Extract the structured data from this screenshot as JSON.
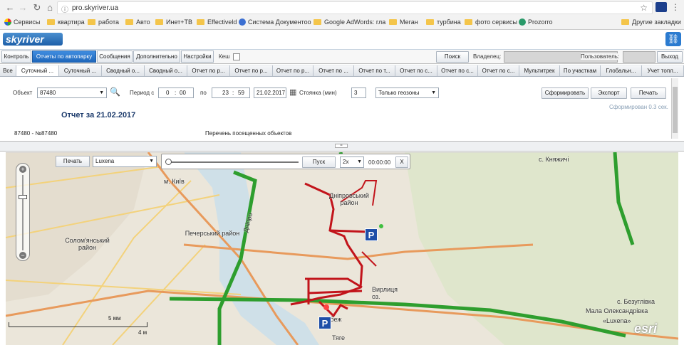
{
  "browser": {
    "url": "pro.skyriver.ua",
    "bookmarks": [
      "Сервисы",
      "квартира",
      "работа",
      "Авто",
      "Инет+ТВ",
      "Effectiveld",
      "Система Документоо",
      "Google AdWords: гла",
      "Меган",
      "турбина",
      "фото сервисы",
      "Prozorro"
    ],
    "other_bookmarks": "Другие закладки"
  },
  "app": {
    "logo": "skyriver"
  },
  "top_nav": {
    "tabs": [
      "Контроль",
      "Отчеты по автопарку",
      "Сообщения",
      "Дополнительно",
      "Настройки"
    ],
    "active_index": 1,
    "cache_label": "Кеш",
    "search_button": "Поиск",
    "owner_label": "Владелец:",
    "user_label": "Пользователь:",
    "exit_button": "Выход"
  },
  "report_tabs": [
    "Все",
    "Суточный ...",
    "Суточный ...",
    "Сводный о...",
    "Сводный о...",
    "Отчет по р...",
    "Отчет по р...",
    "Отчет по р...",
    "Отчет по ...",
    "Отчет по т...",
    "Отчет по с...",
    "Отчет по с...",
    "Отчет по с...",
    "Мультитрек",
    "По участкам",
    "Глобальн...",
    "Учет топл..."
  ],
  "form": {
    "object_label": "Объект",
    "object_value": "87480",
    "period_from_label": "Период с",
    "from_h": "0",
    "from_m": "00",
    "to_label": "по",
    "to_h": "23",
    "to_m": "59",
    "date": "21.02.2017",
    "stop_label": "Стоянка (мин)",
    "stop_value": "3",
    "geozone_value": "Только геозоны",
    "generate_button": "Сформировать",
    "export_button": "Экспорт",
    "print_button": "Печать",
    "generated_note": "Сформирован 0.3 сек."
  },
  "report": {
    "title": "Отчет за 21.02.2017",
    "row_left": "87480 - №87480",
    "row_right": "Перечень посещенных объектов"
  },
  "map": {
    "print_button": "Печать",
    "object_value": "Luxena",
    "play_button": "Пуск",
    "speed": "2x",
    "time": "00:00:00",
    "close": "X",
    "labels": {
      "kyiv": "м. Київ",
      "dnipro": "Дніпровський район",
      "pechersk": "Печерський район",
      "solomyan": "Солом'янський район",
      "knyazhychi": "с. Княжичі",
      "bezuhlivka": "с. Безуглівка",
      "mala_oleks": "Мала Олександрівка",
      "luxena": "«Luxena»",
      "dnipro_river": "Дніпро",
      "ozero": "Вирлиця оз.",
      "nebesh": "Небеж оз.",
      "tyahe": "Тяге"
    },
    "scale_top": "5 мм",
    "scale_bottom": "4 м",
    "esri": "esri"
  },
  "colors": {
    "route": "#c2141b",
    "highway": "#2e9e2e",
    "accent": "#1f67bb"
  }
}
